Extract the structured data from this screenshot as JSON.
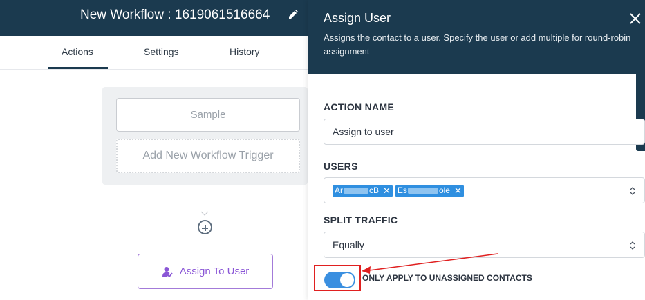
{
  "workflow": {
    "title": "New Workflow : 1619061516664",
    "tabs": [
      {
        "label": "Actions",
        "active": true
      },
      {
        "label": "Settings",
        "active": false
      },
      {
        "label": "History",
        "active": false
      }
    ]
  },
  "canvas": {
    "trigger_sample": "Sample",
    "add_trigger": "Add New Workflow Trigger",
    "action_node": "Assign To User"
  },
  "drawer": {
    "title": "Assign User",
    "description": "Assigns the contact to a user. Specify the user or add multiple for round-robin assignment",
    "action_name_label": "ACTION NAME",
    "action_name_value": "Assign to user",
    "users_label": "USERS",
    "users": [
      {
        "prefix": "Ar",
        "suffix": "cB"
      },
      {
        "prefix": "Es",
        "suffix": "ole"
      }
    ],
    "split_label": "SPLIT TRAFFIC",
    "split_value": "Equally",
    "toggle_label": "ONLY APPLY TO UNASSIGNED CONTACTS",
    "toggle_on": true
  },
  "colors": {
    "header_bg": "#1b3a4f",
    "accent_purple": "#8a56d6",
    "chip_blue": "#2f8fe0",
    "toggle_blue": "#3a8fe0",
    "annotation_red": "#e02020"
  }
}
